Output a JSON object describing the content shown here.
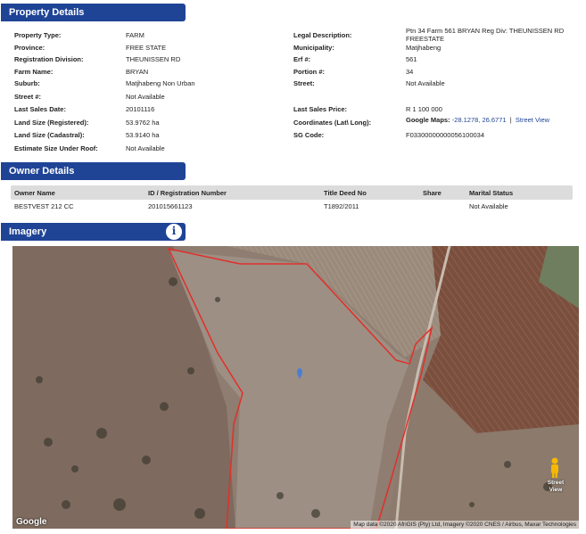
{
  "sections": {
    "property": "Property Details",
    "owner": "Owner Details",
    "imagery": "Imagery"
  },
  "property": {
    "left": [
      {
        "label": "Property Type:",
        "value": "FARM"
      },
      {
        "label": "Province:",
        "value": "FREE STATE"
      },
      {
        "label": "Registration Division:",
        "value": "THEUNISSEN RD"
      },
      {
        "label": "Farm Name:",
        "value": "BRYAN"
      },
      {
        "label": "Suburb:",
        "value": "Matjhabeng Non Urban"
      },
      {
        "label": "Street #:",
        "value": "Not Available"
      },
      {
        "label": "Last Sales Date:",
        "value": "20101116"
      },
      {
        "label": "Land Size (Registered):",
        "value": "53.9762 ha"
      },
      {
        "label": "Land Size (Cadastral):",
        "value": "53.9140 ha"
      },
      {
        "label": "Estimate Size Under Roof:",
        "value": "Not Available"
      }
    ],
    "right": {
      "legal_label": "Legal Description:",
      "legal_value": "Ptn 34 Farm 561 BRYAN Reg Div: THEUNISSEN RD FREESTATE",
      "municipality_label": "Municipality:",
      "municipality_value": "Matjhabeng",
      "erf_label": "Erf #:",
      "erf_value": "561",
      "portion_label": "Portion #:",
      "portion_value": "34",
      "street_label": "Street:",
      "street_value": "Not Available",
      "price_label": "Last Sales Price:",
      "price_value": "R 1 100 000",
      "coords_label": "Coordinates (Lat\\ Long):",
      "coords_prefix": "Google Maps:",
      "coords_value": "-28.1278, 26.6771",
      "coords_sep": "|",
      "street_view_link": "Street View",
      "sg_label": "SG Code:",
      "sg_value": "F03300000000056100034"
    }
  },
  "owner": {
    "headers": [
      "Owner Name",
      "ID / Registration Number",
      "Title Deed No",
      "Share",
      "Marital Status"
    ],
    "row": [
      "BESTVEST 212 CC",
      "201015661123",
      "T1892/2011",
      "",
      "Not Available"
    ]
  },
  "map": {
    "google": "Google",
    "attribution": "Map data ©2020 AfriGIS (Pty) Ltd, Imagery ©2020 CNES / Airbus, Maxar Technologies",
    "street_view_label": "Street View",
    "info_icon": "info-icon",
    "boundary_color": "#e0302a",
    "pin_color": "#4a7fd0"
  }
}
